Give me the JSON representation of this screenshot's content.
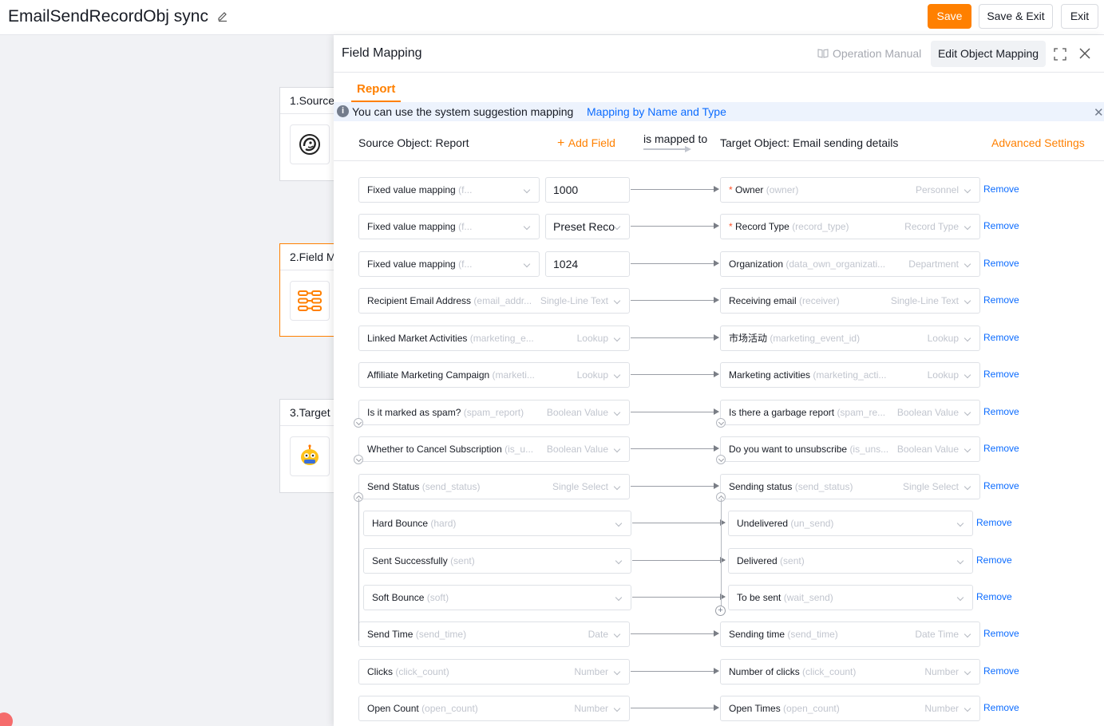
{
  "header": {
    "title": "EmailSendRecordObj sync",
    "save_label": "Save",
    "save_exit_label": "Save & Exit",
    "exit_label": "Exit"
  },
  "steps": [
    {
      "label": "1.Source",
      "icon": "mailchimp-logo-icon"
    },
    {
      "label": "2.Field M",
      "icon": "field-mapping-icon"
    },
    {
      "label": "3.Target",
      "icon": "target-app-logo-icon"
    }
  ],
  "drawer": {
    "title": "Field Mapping",
    "operation_manual": "Operation Manual",
    "edit_object_mapping": "Edit Object Mapping",
    "tab": "Report",
    "notice_text": "You can use the system suggestion mapping",
    "notice_link": "Mapping by Name and Type",
    "source_object_label": "Source Object:  Report",
    "add_field": "Add Field",
    "is_mapped_to": "is mapped to",
    "target_object_label": "Target Object:  Email sending details",
    "advanced_settings": "Advanced Settings",
    "remove_label": "Remove"
  },
  "mappings": [
    {
      "src_name": "Fixed value mapping",
      "src_api": "(f...",
      "src_type": "",
      "value": "1000",
      "tgt_req": "* ",
      "tgt_name": "Owner",
      "tgt_api": "(owner)",
      "tgt_type": "Personnel"
    },
    {
      "src_name": "Fixed value mapping",
      "src_api": "(f...",
      "src_type": "",
      "value": "Preset Reco",
      "tgt_req": "* ",
      "tgt_name": "Record Type",
      "tgt_api": "(record_type)",
      "tgt_type": "Record Type"
    },
    {
      "src_name": "Fixed value mapping",
      "src_api": "(f...",
      "src_type": "",
      "value": "1024",
      "tgt_req": "",
      "tgt_name": "Organization",
      "tgt_api": "(data_own_organizati...",
      "tgt_type": "Department"
    },
    {
      "src_name": "Recipient Email Address",
      "src_api": "(email_addr...",
      "src_type": "Single-Line Text",
      "tgt_req": "",
      "tgt_name": "Receiving email",
      "tgt_api": "(receiver)",
      "tgt_type": "Single-Line Text"
    },
    {
      "src_name": "Linked Market Activities",
      "src_api": "(marketing_e...",
      "src_type": "Lookup",
      "tgt_req": "",
      "tgt_name": "市场活动",
      "tgt_api": "(marketing_event_id)",
      "tgt_type": "Lookup"
    },
    {
      "src_name": "Affiliate Marketing Campaign",
      "src_api": "(marketi...",
      "src_type": "Lookup",
      "tgt_req": "",
      "tgt_name": "Marketing activities",
      "tgt_api": "(marketing_acti...",
      "tgt_type": "Lookup"
    },
    {
      "src_name": "Is it marked as spam?",
      "src_api": "(spam_report)",
      "src_type": "Boolean Value",
      "tgt_req": "",
      "tgt_name": "Is there a garbage report",
      "tgt_api": "(spam_re...",
      "tgt_type": "Boolean Value"
    },
    {
      "src_name": "Whether to Cancel Subscription",
      "src_api": "(is_u...",
      "src_type": "Boolean Value",
      "tgt_req": "",
      "tgt_name": "Do you want to unsubscribe",
      "tgt_api": "(is_uns...",
      "tgt_type": "Boolean Value"
    },
    {
      "src_name": "Send Status",
      "src_api": "(send_status)",
      "src_type": "Single Select",
      "tgt_req": "",
      "tgt_name": "Sending status",
      "tgt_api": "(send_status)",
      "tgt_type": "Single Select"
    },
    {
      "src_name": "Hard Bounce",
      "src_api": "(hard)",
      "src_type": "",
      "tgt_req": "",
      "tgt_name": "Undelivered",
      "tgt_api": "(un_send)",
      "tgt_type": ""
    },
    {
      "src_name": "Sent Successfully",
      "src_api": "(sent)",
      "src_type": "",
      "tgt_req": "",
      "tgt_name": "Delivered",
      "tgt_api": "(sent)",
      "tgt_type": ""
    },
    {
      "src_name": "Soft Bounce",
      "src_api": "(soft)",
      "src_type": "",
      "tgt_req": "",
      "tgt_name": "To be sent",
      "tgt_api": "(wait_send)",
      "tgt_type": ""
    },
    {
      "src_name": "Send Time",
      "src_api": "(send_time)",
      "src_type": "Date",
      "tgt_req": "",
      "tgt_name": "Sending time",
      "tgt_api": "(send_time)",
      "tgt_type": "Date Time"
    },
    {
      "src_name": "Clicks",
      "src_api": "(click_count)",
      "src_type": "Number",
      "tgt_req": "",
      "tgt_name": "Number of clicks",
      "tgt_api": "(click_count)",
      "tgt_type": "Number"
    },
    {
      "src_name": "Open Count",
      "src_api": "(open_count)",
      "src_type": "Number",
      "tgt_req": "",
      "tgt_name": "Open Times",
      "tgt_api": "(open_count)",
      "tgt_type": "Number"
    }
  ]
}
